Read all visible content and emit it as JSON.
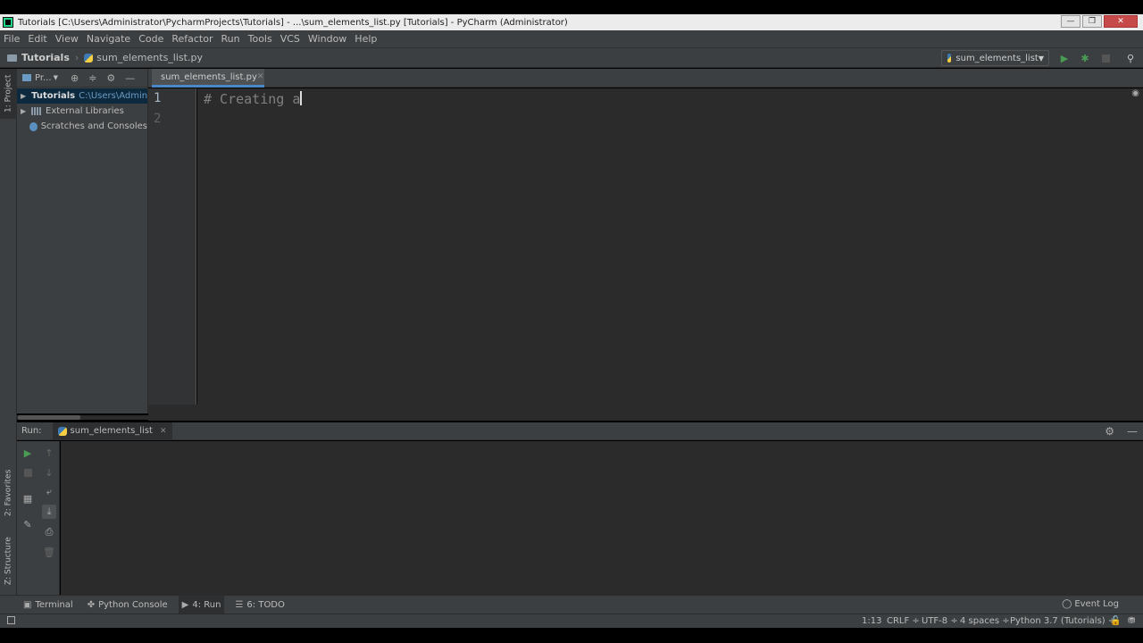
{
  "window": {
    "title": "Tutorials [C:\\Users\\Administrator\\PycharmProjects\\Tutorials] - ...\\sum_elements_list.py [Tutorials] - PyCharm (Administrator)",
    "controls": [
      "minimize",
      "maximize",
      "close"
    ]
  },
  "menu": {
    "items": [
      "File",
      "Edit",
      "View",
      "Navigate",
      "Code",
      "Refactor",
      "Run",
      "Tools",
      "VCS",
      "Window",
      "Help"
    ]
  },
  "navbar": {
    "project": "Tutorials",
    "file": "sum_elements_list.py",
    "run_config": "sum_elements_list"
  },
  "sidebar": {
    "project_tab": "1: Project",
    "favorites_tab": "2: Favorites",
    "structure_tab": "Z: Structure"
  },
  "project_panel": {
    "title": "Pr...",
    "tree": [
      {
        "label": "Tutorials",
        "path": "C:\\Users\\Admin"
      },
      {
        "label": "External Libraries",
        "path": ""
      },
      {
        "label": "Scratches and Consoles",
        "path": ""
      }
    ]
  },
  "editor": {
    "tab_label": "sum_elements_list.py",
    "line_numbers": [
      "1",
      "2"
    ],
    "code_line_1": "# Creating a"
  },
  "run_panel": {
    "label": "Run:",
    "tab_label": "sum_elements_list"
  },
  "bottom_tabs": {
    "terminal": "Terminal",
    "python_console": "Python Console",
    "run": "4: Run",
    "todo": "6: TODO",
    "event_log": "Event Log"
  },
  "status": {
    "position": "1:13",
    "line_sep": "CRLF ÷",
    "encoding": "UTF-8 ÷",
    "indent": "4 spaces ÷",
    "interpreter": "Python 3.7 (Tutorials) ÷"
  },
  "colors": {
    "panel": "#3c3f41",
    "editor_bg": "#2b2b2b",
    "comment": "#808080",
    "accent": "#4a88c7",
    "run_green": "#499c54"
  }
}
